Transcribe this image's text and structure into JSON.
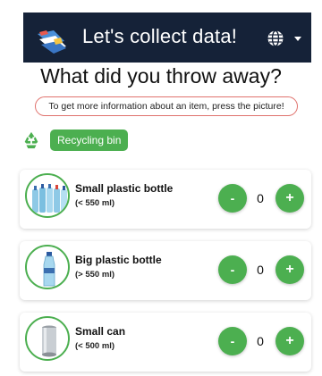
{
  "app": {
    "title": "Let's collect data!",
    "logo_icon": "flag-logo-icon",
    "language_icon": "globe-icon",
    "dropdown_icon": "chevron-down-icon",
    "header_color": "#152238"
  },
  "main": {
    "question": "What did you throw away?",
    "hint": "To get more information about an item, press the picture!",
    "bin": {
      "icon": "recycle-icon",
      "label": "Recycling bin"
    }
  },
  "items": [
    {
      "name": "Small plastic bottle",
      "size": "(< 550 ml)",
      "count": "0",
      "minus": "-",
      "plus": "+",
      "icon": "small-plastic-bottles-icon"
    },
    {
      "name": "Big plastic bottle",
      "size": "(> 550 ml)",
      "count": "0",
      "minus": "-",
      "plus": "+",
      "icon": "big-plastic-bottle-icon"
    },
    {
      "name": "Small can",
      "size": "(< 500 ml)",
      "count": "0",
      "minus": "-",
      "plus": "+",
      "icon": "small-can-icon"
    }
  ],
  "colors": {
    "accent": "#4caf50",
    "hint_border": "#e0726d"
  }
}
